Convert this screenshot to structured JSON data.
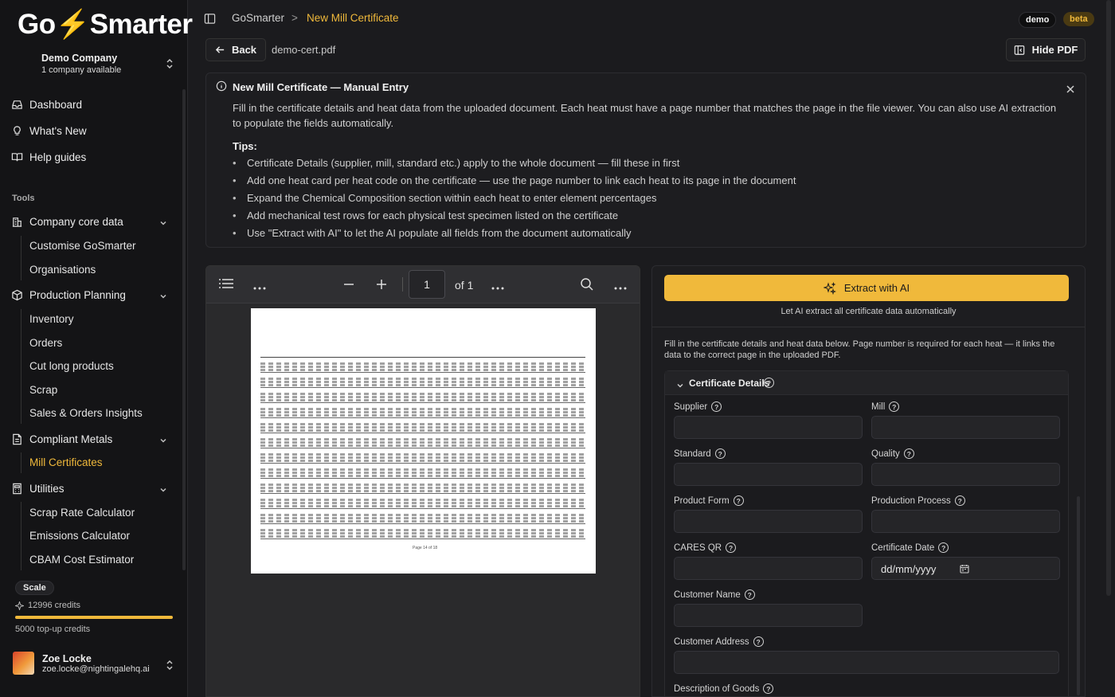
{
  "sidebar": {
    "logo": {
      "pre": "Go",
      "bolt": "⚡",
      "post": "Smarter"
    },
    "company": {
      "name": "Demo Company",
      "sub": "1 company available"
    },
    "nav": [
      {
        "label": "Dashboard",
        "icon": "inbox-icon"
      },
      {
        "label": "What's New",
        "icon": "lightbulb-icon"
      },
      {
        "label": "Help guides",
        "icon": "book-icon"
      }
    ],
    "tools_label": "Tools",
    "groups": {
      "company_core": {
        "label": "Company core data",
        "items": [
          "Customise GoSmarter",
          "Organisations"
        ]
      },
      "production": {
        "label": "Production Planning",
        "items": [
          "Inventory",
          "Orders",
          "Cut long products",
          "Scrap",
          "Sales & Orders Insights"
        ]
      },
      "compliant": {
        "label": "Compliant Metals",
        "items": [
          "Mill Certificates"
        ]
      },
      "utilities": {
        "label": "Utilities",
        "items": [
          "Scrap Rate Calculator",
          "Emissions Calculator",
          "CBAM Cost Estimator"
        ]
      }
    },
    "plan": "Scale",
    "credits": "12996 credits",
    "credits_fraction": 1.0,
    "topup": "5000 top-up credits",
    "user": {
      "name": "Zoe Locke",
      "email": "zoe.locke@nightingalehq.ai"
    }
  },
  "header": {
    "breadcrumb_root": "GoSmarter",
    "breadcrumb_sep": ">",
    "breadcrumb_current": "New Mill Certificate",
    "badge_demo": "demo",
    "badge_beta": "beta"
  },
  "toolbar": {
    "back_label": "Back",
    "filename": "demo-cert.pdf",
    "hide_pdf_label": "Hide PDF"
  },
  "banner": {
    "title": "New Mill Certificate — Manual Entry",
    "description": "Fill in the certificate details and heat data from the uploaded document. Each heat must have a page number that matches the page in the file viewer. You can also use AI extraction to populate the fields automatically.",
    "tips_heading": "Tips:",
    "tips": [
      "Certificate Details (supplier, mill, standard etc.) apply to the whole document — fill these in first",
      "Add one heat card per heat code on the certificate — use the page number to link each heat to its page in the document",
      "Expand the Chemical Composition section within each heat to enter element percentages",
      "Add mechanical test rows for each physical test specimen listed on the certificate",
      "Use \"Extract with AI\" to let the AI populate all fields from the document automatically"
    ]
  },
  "viewer": {
    "page_number": "1",
    "page_total": "of 1",
    "page_footer": "Page 14 of 18"
  },
  "form": {
    "extract_label": "Extract with AI",
    "extract_hint": "Let AI extract all certificate data automatically",
    "description": "Fill in the certificate details and heat data below. Page number is required for each heat — it links the data to the correct page in the uploaded PDF.",
    "section_title": "Certificate Details",
    "fields": {
      "supplier": "Supplier",
      "mill": "Mill",
      "standard": "Standard",
      "quality": "Quality",
      "product_form": "Product Form",
      "production_process": "Production Process",
      "cares_qr": "CARES QR",
      "certificate_date": "Certificate Date",
      "customer_name": "Customer Name",
      "customer_address": "Customer Address",
      "description_of_goods": "Description of Goods"
    },
    "date_placeholder": "dd/mm/yyyy"
  },
  "colors": {
    "accent": "#f0b93b",
    "background": "#1b1b1e",
    "sidebar": "#141416"
  }
}
